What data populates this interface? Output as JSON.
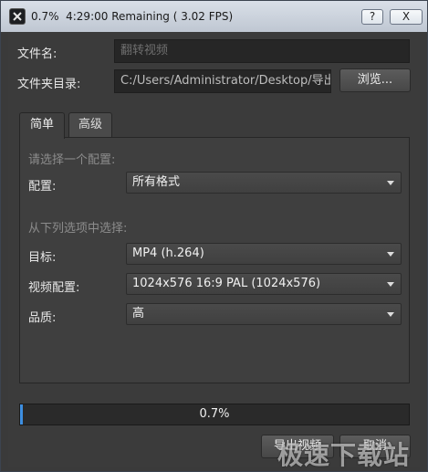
{
  "window": {
    "title": "0.7%  4:29:00 Remaining ( 3.02 FPS)",
    "help_label": "?",
    "close_label": "X"
  },
  "form": {
    "filename_label": "文件名:",
    "filename_value": "翻转视频",
    "folder_label": "文件夹目录:",
    "folder_value": "C:/Users/Administrator/Desktop/导出",
    "browse_label": "浏览..."
  },
  "tabs": [
    {
      "label": "简单",
      "active": true
    },
    {
      "label": "高级",
      "active": false
    }
  ],
  "simple": {
    "choose_preset_heading": "请选择一个配置:",
    "preset_label": "配置:",
    "preset_value": "所有格式",
    "choose_options_heading": "从下列选项中选择:",
    "target_label": "目标:",
    "target_value": "MP4 (h.264)",
    "video_profile_label": "视频配置:",
    "video_profile_value": "1024x576 16:9 PAL (1024x576)",
    "quality_label": "品质:",
    "quality_value": "高"
  },
  "progress": {
    "value_percent": 0.7,
    "text": "0.7%",
    "fill_color": "#3d8ee0"
  },
  "footer": {
    "export_label": "导出视频",
    "cancel_label": "取消"
  },
  "watermark": "极速下载站",
  "icons": {
    "app": "openshot-app-icon",
    "dropdown": "chevron-down-icon"
  }
}
